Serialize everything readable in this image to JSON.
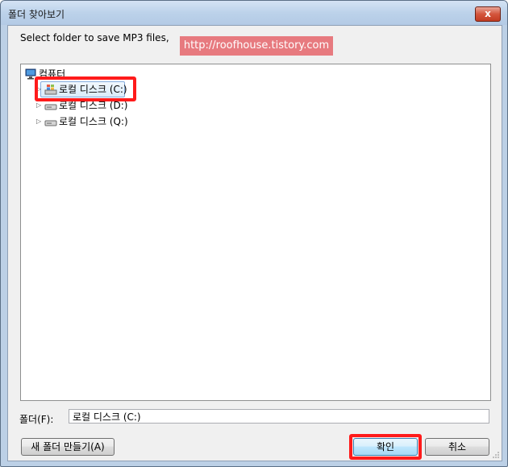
{
  "window": {
    "title": "폴더 찾아보기",
    "close_label": "x"
  },
  "instruction": "Select folder to save MP3 files,",
  "watermark": "http://roofhouse.tistory.com",
  "tree": {
    "root": {
      "label": "컴퓨터",
      "icon": "computer-icon"
    },
    "items": [
      {
        "label": "로컬 디스크 (C:)",
        "icon": "windows-drive-icon",
        "selected": true
      },
      {
        "label": "로컬 디스크 (D:)",
        "icon": "hard-drive-icon",
        "selected": false
      },
      {
        "label": "로컬 디스크 (Q:)",
        "icon": "hard-drive-icon",
        "selected": false
      }
    ]
  },
  "folder": {
    "label": "폴더(F):",
    "value": "로컬 디스크 (C:)"
  },
  "buttons": {
    "new_folder": "새 폴더 만들기(A)",
    "ok": "확인",
    "cancel": "취소"
  },
  "colors": {
    "highlight": "#ff1b1b",
    "watermark_bg": "#e77a7f"
  }
}
